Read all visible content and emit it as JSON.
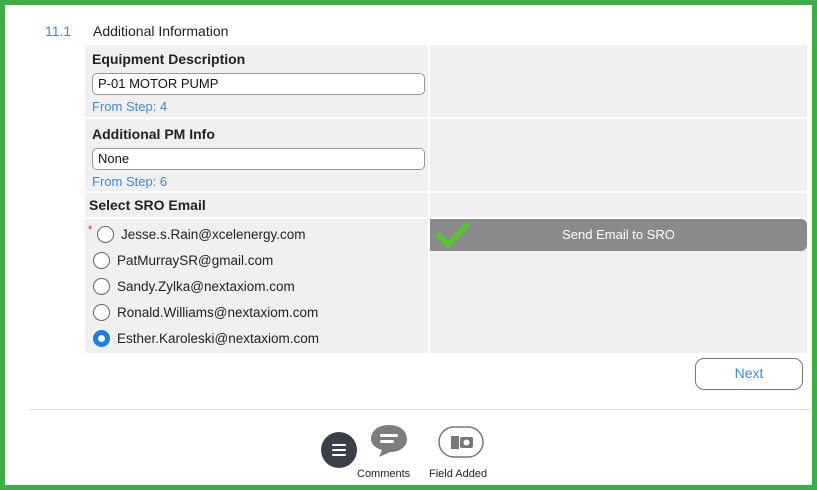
{
  "step": {
    "number": "11.1",
    "title": "Additional Information"
  },
  "equipment": {
    "label": "Equipment Description",
    "value": "P-01 MOTOR PUMP",
    "from_step": "From Step: 4"
  },
  "pm_info": {
    "label": "Additional PM Info",
    "value": "None",
    "from_step": "From Step: 6"
  },
  "sro": {
    "label": "Select SRO Email",
    "required_mark": "*",
    "options": [
      {
        "email": "Jesse.s.Rain@xcelenergy.com",
        "selected": false
      },
      {
        "email": "PatMurraySR@gmail.com",
        "selected": false
      },
      {
        "email": "Sandy.Zylka@nextaxiom.com",
        "selected": false
      },
      {
        "email": "Ronald.Williams@nextaxiom.com",
        "selected": false
      },
      {
        "email": "Esther.Karoleski@nextaxiom.com",
        "selected": true
      }
    ]
  },
  "send_button": {
    "label": "Send Email to SRO",
    "icon": "checkmark-icon"
  },
  "next_button": {
    "label": "Next"
  },
  "toolbar": {
    "menu_icon": "menu-icon",
    "comments_label": "Comments",
    "comments_icon": "comment-bubble-icon",
    "field_added_label": "Field Added",
    "field_added_icon": "camera-icon"
  },
  "colors": {
    "frame_border": "#3fae49",
    "accent_blue": "#3a8be0",
    "radio_selected": "#1a7ef0",
    "send_button_bg": "#8a8a8a",
    "checkmark_green": "#5cc236"
  }
}
